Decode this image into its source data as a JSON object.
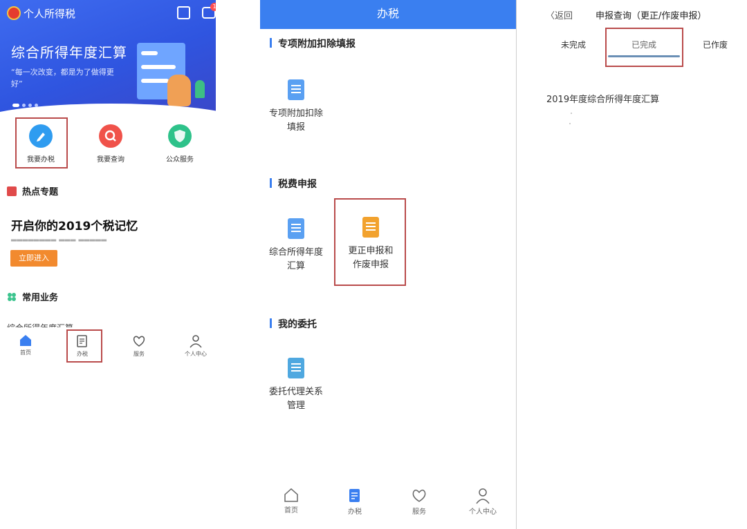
{
  "screen1": {
    "app_name": "个人所得税",
    "notification_count": "1",
    "banner": {
      "title": "综合所得年度汇算",
      "subtitle": "“每一次改变，都是为了做得更好”"
    },
    "quick_actions": [
      {
        "label": "我要办税",
        "icon": "pen-icon",
        "color": "#2f9cf0"
      },
      {
        "label": "我要查询",
        "icon": "search-icon",
        "color": "#f0524a"
      },
      {
        "label": "公众服务",
        "icon": "shield-heart-icon",
        "color": "#2ec28a"
      }
    ],
    "hot_section": {
      "title": "热点专题",
      "headline": "开启你的2019个税记忆",
      "enter_label": "立即进入"
    },
    "common_section": {
      "title": "常用业务",
      "first_item": "综合所得年度汇算"
    },
    "nav": [
      "首页",
      "办税",
      "服务",
      "个人中心"
    ]
  },
  "screen2": {
    "header_title": "办税",
    "sections": [
      {
        "title": "专项附加扣除填报",
        "items": [
          {
            "label": "专项附加扣除\n填报",
            "icon": "form-edit-icon",
            "color": "#5aa0f2"
          }
        ]
      },
      {
        "title": "税费申报",
        "items": [
          {
            "label": "综合所得年度\n汇算",
            "icon": "tax-doc-icon",
            "color": "#5aa0f2"
          },
          {
            "label": "更正申报和\n作废申报",
            "icon": "correction-doc-icon",
            "color": "#f2a22e"
          }
        ]
      },
      {
        "title": "我的委托",
        "items": [
          {
            "label": "委托代理关系\n管理",
            "icon": "delegation-doc-icon",
            "color": "#4fa8e0"
          }
        ]
      }
    ],
    "nav": [
      "首页",
      "办税",
      "服务",
      "个人中心"
    ]
  },
  "screen3": {
    "back_label": "〈返回",
    "title": "申报查询（更正/作废申报）",
    "tabs": [
      "未完成",
      "已完成",
      "已作废"
    ],
    "active_tab": "已完成",
    "record": "2019年度综合所得年度汇算"
  },
  "colors": {
    "brand_blue": "#3a7ff0",
    "highlight_box": "#b94a4a",
    "enter_button": "#f28a2e"
  }
}
